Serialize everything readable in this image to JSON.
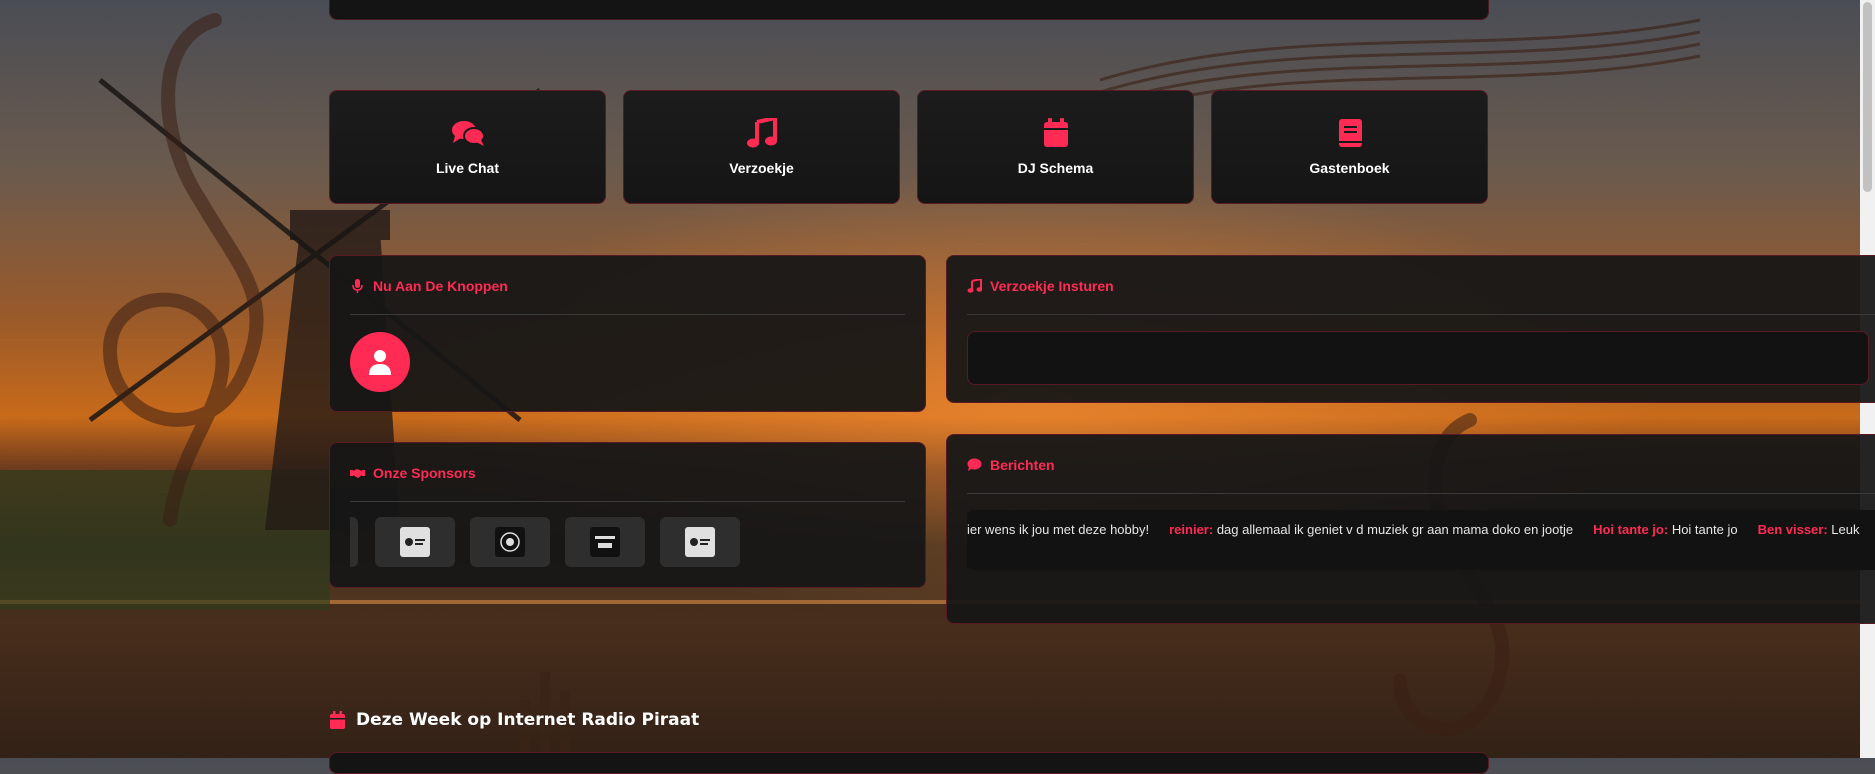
{
  "quick_links": [
    {
      "label": "Live Chat",
      "icon": "comments-icon"
    },
    {
      "label": "Verzoekje",
      "icon": "music-note-icon"
    },
    {
      "label": "DJ Schema",
      "icon": "calendar-icon"
    },
    {
      "label": "Gastenboek",
      "icon": "book-icon"
    }
  ],
  "now_on_air": {
    "title": "Nu Aan De Knoppen",
    "icon": "microphone-icon",
    "avatar_icon": "user-icon"
  },
  "request": {
    "title": "Verzoekje Insturen",
    "icon": "music-note-icon"
  },
  "sponsors": {
    "title": "Onze Sponsors",
    "icon": "handshake-icon",
    "logos": [
      "sponsor-logo-1",
      "sponsor-logo-2",
      "sponsor-logo-3",
      "sponsor-logo-4"
    ]
  },
  "messages": {
    "title": "Berichten",
    "icon": "comment-icon",
    "lead_text": "ier wens ik jou met deze hobby!",
    "items": [
      {
        "author": "reinier:",
        "text": "dag allemaal ik geniet v d muziek gr aan mama doko en jootje"
      },
      {
        "author": "Hoi tante jo:",
        "text": "Hoi tante jo"
      },
      {
        "author": "Ben visser:",
        "text": "Leuk"
      }
    ]
  },
  "week": {
    "title": "Deze Week op Internet Radio Piraat",
    "icon": "calendar-icon"
  },
  "colors": {
    "accent": "#ff2b55",
    "panel": "#161616",
    "border": "#5a1a24"
  }
}
